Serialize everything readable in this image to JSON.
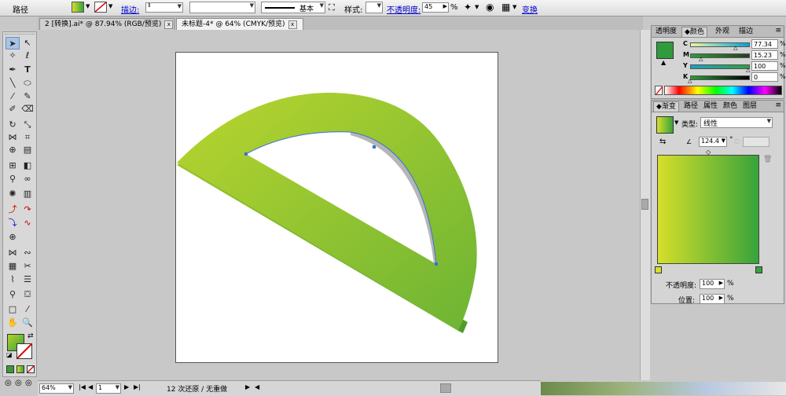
{
  "control_bar": {
    "object_label": "路径",
    "stroke_label": "描边:",
    "stroke_profile": "基本",
    "style_label": "样式:",
    "opacity_label": "不透明度:",
    "opacity_value": "45",
    "opacity_unit": "%",
    "transform_label": "变换"
  },
  "tabs": [
    {
      "label": "2 [转换].ai* @ 87.94% (RGB/预览)"
    },
    {
      "label": "未标题-4* @ 64% (CMYK/预览)"
    }
  ],
  "color_panel": {
    "tabs": [
      "透明度",
      "颜色",
      "外观",
      "描边"
    ],
    "channels": [
      {
        "name": "C",
        "value": "77.34"
      },
      {
        "name": "M",
        "value": "15.23"
      },
      {
        "name": "Y",
        "value": "100"
      },
      {
        "name": "K",
        "value": "0"
      }
    ],
    "unit": "%"
  },
  "gradient_panel": {
    "tabs": [
      "渐变",
      "路径",
      "属性",
      "颜色",
      "图层"
    ],
    "type_label": "类型:",
    "type_value": "线性",
    "angle_value": "124.4",
    "angle_unit": "°",
    "opacity_label": "不透明度:",
    "opacity_value": "100",
    "position_label": "位置:",
    "position_value": "100",
    "unit": "%"
  },
  "status": {
    "zoom": "64%",
    "page": "1",
    "undo_text": "12 次还原 / 无重做"
  },
  "colors": {
    "gradient_start": "#d6df2a",
    "gradient_end": "#37a33b",
    "protractor_light": "#b5d12d",
    "protractor_dark": "#6fb033"
  }
}
